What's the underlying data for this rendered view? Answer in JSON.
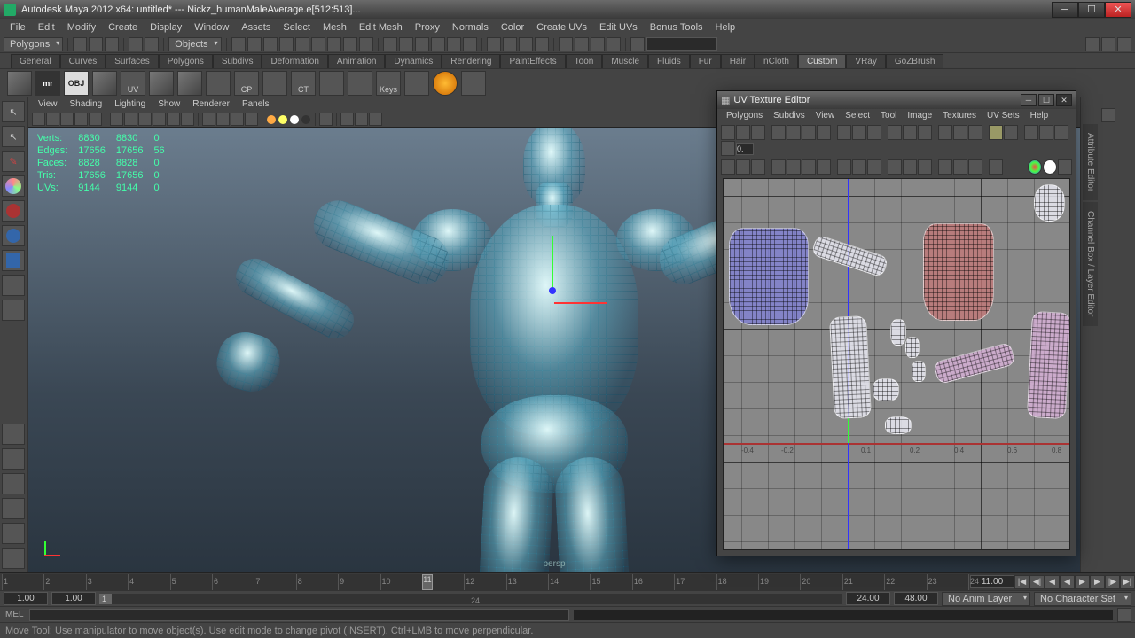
{
  "title": "Autodesk Maya 2012 x64: untitled*  ---  Nickz_humanMaleAverage.e[512:513]...",
  "menubar": [
    "File",
    "Edit",
    "Modify",
    "Create",
    "Display",
    "Window",
    "Assets",
    "Select",
    "Mesh",
    "Edit Mesh",
    "Proxy",
    "Normals",
    "Color",
    "Create UVs",
    "Edit UVs",
    "Bonus Tools",
    "Help"
  ],
  "status": {
    "module": "Polygons",
    "mask_label": "Objects"
  },
  "shelf_tabs": [
    "General",
    "Curves",
    "Surfaces",
    "Polygons",
    "Subdivs",
    "Deformation",
    "Animation",
    "Dynamics",
    "Rendering",
    "PaintEffects",
    "Toon",
    "Muscle",
    "Fluids",
    "Fur",
    "Hair",
    "nCloth",
    "Custom",
    "VRay",
    "GoZBrush"
  ],
  "shelf_active": "Custom",
  "panel_menus": [
    "View",
    "Shading",
    "Lighting",
    "Show",
    "Renderer",
    "Panels"
  ],
  "hud": {
    "rows": [
      {
        "label": "Verts:",
        "a": "8830",
        "b": "8830",
        "c": "0"
      },
      {
        "label": "Edges:",
        "a": "17656",
        "b": "17656",
        "c": "56"
      },
      {
        "label": "Faces:",
        "a": "8828",
        "b": "8828",
        "c": "0"
      },
      {
        "label": "Tris:",
        "a": "17656",
        "b": "17656",
        "c": "0"
      },
      {
        "label": "UVs:",
        "a": "9144",
        "b": "9144",
        "c": "0"
      }
    ]
  },
  "camera": "persp",
  "uv_editor": {
    "title": "UV Texture Editor",
    "menus": [
      "Polygons",
      "Subdivs",
      "View",
      "Select",
      "Tool",
      "Image",
      "Textures",
      "UV Sets",
      "Help"
    ]
  },
  "right_tabs": [
    "Attribute Editor",
    "Channel Box / Layer Editor"
  ],
  "timeline": {
    "current": "11.00",
    "marks": [
      1,
      2,
      3,
      4,
      5,
      6,
      7,
      8,
      9,
      10,
      11,
      12,
      13,
      14,
      15,
      16,
      17,
      18,
      19,
      20,
      21,
      22,
      23,
      24
    ],
    "scrub_at": 11
  },
  "range": {
    "start": "1.00",
    "in": "1.00",
    "range_start": "1",
    "mid": "24",
    "out": "24.00",
    "end": "48.00",
    "anim_layer": "No Anim Layer",
    "char_set": "No Character Set"
  },
  "cmd_label": "MEL",
  "help_line": "Move Tool: Use manipulator to move object(s). Use edit mode to change pivot (INSERT). Ctrl+LMB to move perpendicular."
}
